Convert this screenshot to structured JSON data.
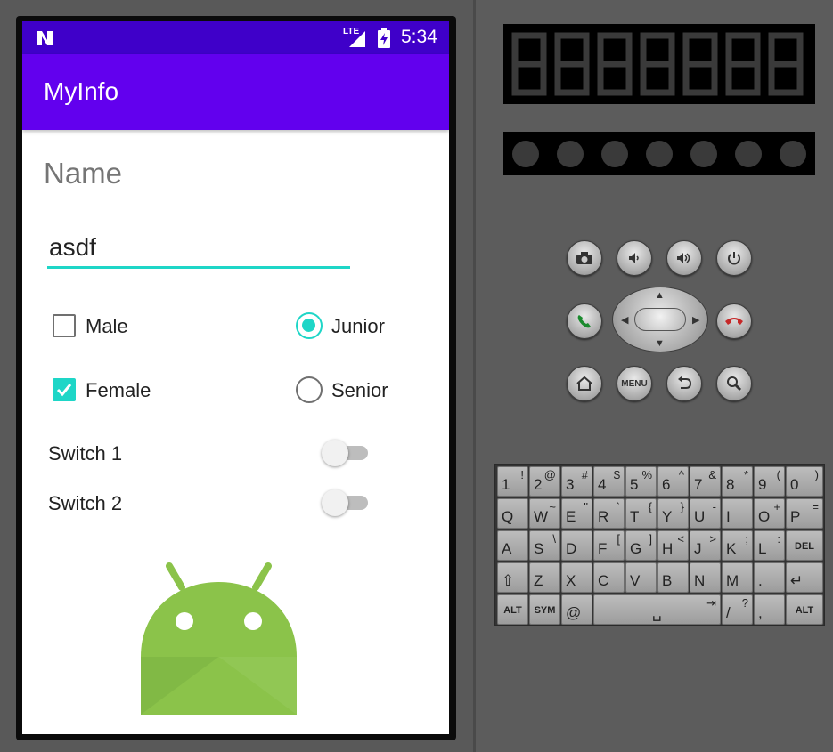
{
  "status_bar": {
    "network": "LTE",
    "time": "5:34"
  },
  "app_bar": {
    "title": "MyInfo"
  },
  "form": {
    "name_label": "Name",
    "name_value": "asdf",
    "checkboxes": [
      {
        "label": "Male",
        "checked": false
      },
      {
        "label": "Female",
        "checked": true
      }
    ],
    "radios": [
      {
        "label": "Junior",
        "selected": true
      },
      {
        "label": "Senior",
        "selected": false
      }
    ],
    "switches": [
      {
        "label": "Switch 1",
        "on": false
      },
      {
        "label": "Switch 2",
        "on": false
      }
    ]
  },
  "colors": {
    "status_bar": "#3f00c9",
    "app_bar": "#6200ee",
    "accent": "#1ed6c7",
    "android_green": "#8bc34a"
  },
  "emulator": {
    "hw_buttons": [
      {
        "name": "camera",
        "icon": "camera-icon"
      },
      {
        "name": "volume-down",
        "icon": "volume-down-icon"
      },
      {
        "name": "volume-up",
        "icon": "volume-up-icon"
      },
      {
        "name": "power",
        "icon": "power-icon"
      },
      {
        "name": "call",
        "icon": "call-icon"
      },
      {
        "name": "end-call",
        "icon": "end-call-icon"
      },
      {
        "name": "home",
        "icon": "home-icon"
      },
      {
        "name": "menu",
        "label": "MENU"
      },
      {
        "name": "back",
        "icon": "back-icon"
      },
      {
        "name": "search",
        "icon": "search-icon"
      }
    ],
    "keyboard": {
      "rows": [
        [
          [
            "1",
            "!"
          ],
          [
            "2",
            "@"
          ],
          [
            "3",
            "#"
          ],
          [
            "4",
            "$"
          ],
          [
            "5",
            "%"
          ],
          [
            "6",
            "^"
          ],
          [
            "7",
            "&"
          ],
          [
            "8",
            "*"
          ],
          [
            "9",
            "("
          ],
          [
            "0",
            ")"
          ]
        ],
        [
          [
            "Q",
            ""
          ],
          [
            "W",
            "~"
          ],
          [
            "E",
            "\""
          ],
          [
            "R",
            "`"
          ],
          [
            "T",
            "{"
          ],
          [
            "Y",
            "}"
          ],
          [
            "U",
            "-"
          ],
          [
            "I",
            ""
          ],
          [
            "O",
            "+"
          ],
          [
            "P",
            "="
          ]
        ],
        [
          [
            "A",
            ""
          ],
          [
            "S",
            "\\"
          ],
          [
            "D",
            ""
          ],
          [
            "F",
            "["
          ],
          [
            "G",
            "]"
          ],
          [
            "H",
            "<"
          ],
          [
            "J",
            ">"
          ],
          [
            "K",
            ";"
          ],
          [
            "L",
            ":"
          ],
          [
            "DEL",
            ""
          ]
        ],
        [
          [
            "⇧",
            ""
          ],
          [
            "Z",
            ""
          ],
          [
            "X",
            ""
          ],
          [
            "C",
            ""
          ],
          [
            "V",
            ""
          ],
          [
            "B",
            ""
          ],
          [
            "N",
            ""
          ],
          [
            "M",
            ""
          ],
          [
            ".",
            ""
          ],
          [
            "↵",
            ""
          ]
        ]
      ],
      "bottom": {
        "alt_left": "ALT",
        "sym": "SYM",
        "at": "@",
        "space": "␣",
        "tab": "⇥",
        "slash": "/",
        "question": "?",
        "comma": ",",
        "alt_right": "ALT"
      }
    }
  }
}
